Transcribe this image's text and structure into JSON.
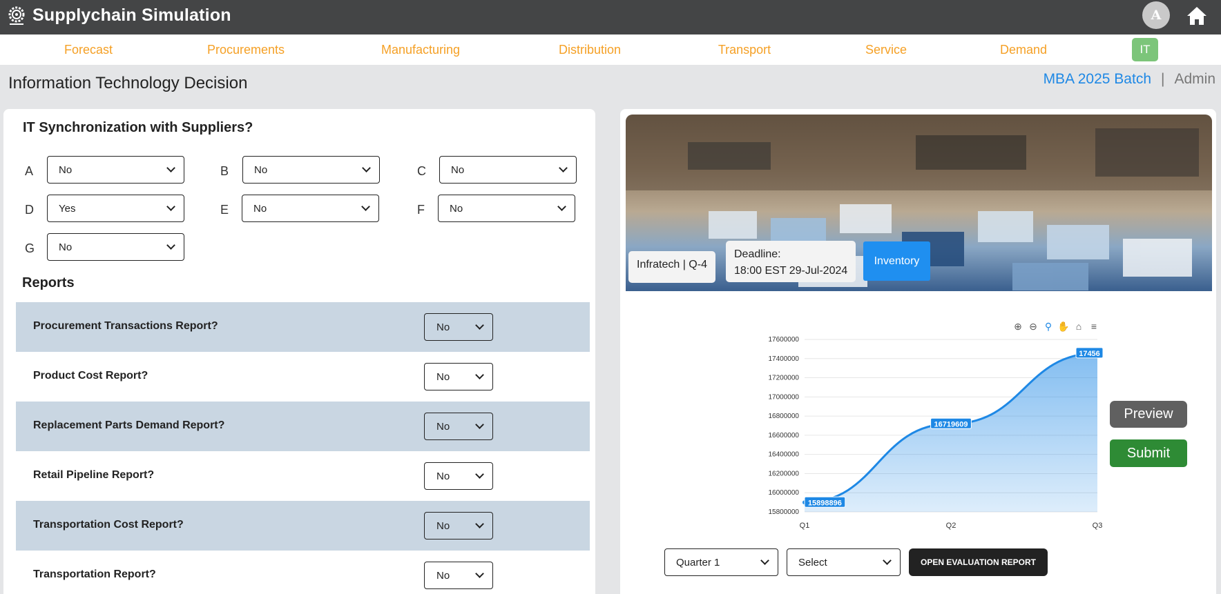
{
  "app": {
    "title": "Supplychain Simulation",
    "avatar_letter": "A"
  },
  "nav": {
    "items": [
      "Forecast",
      "Procurements",
      "Manufacturing",
      "Distribution",
      "Transport",
      "Service",
      "Demand"
    ],
    "active": "IT"
  },
  "page": {
    "title": "Information Technology Decision",
    "batch": "MBA 2025 Batch",
    "separator": "|",
    "role": "Admin"
  },
  "sync": {
    "title": "IT Synchronization with Suppliers?",
    "fields": [
      {
        "label": "A",
        "value": "No"
      },
      {
        "label": "B",
        "value": "No"
      },
      {
        "label": "C",
        "value": "No"
      },
      {
        "label": "D",
        "value": "Yes"
      },
      {
        "label": "E",
        "value": "No"
      },
      {
        "label": "F",
        "value": "No"
      },
      {
        "label": "G",
        "value": "No"
      }
    ]
  },
  "reports": {
    "title": "Reports",
    "rows": [
      {
        "label": "Procurement Transactions Report?",
        "value": "No"
      },
      {
        "label": "Product Cost Report?",
        "value": "No"
      },
      {
        "label": "Replacement Parts Demand Report?",
        "value": "No"
      },
      {
        "label": "Retail Pipeline Report?",
        "value": "No"
      },
      {
        "label": "Transportation Cost Report?",
        "value": "No"
      },
      {
        "label": "Transportation Report?",
        "value": "No"
      }
    ]
  },
  "banner": {
    "team": "Infratech | Q-4",
    "deadline_label": "Deadline:",
    "deadline": "18:00 EST 29-Jul-2024",
    "inventory_label": "Inventory"
  },
  "actions": {
    "preview": "Preview",
    "submit": "Submit",
    "quarter": "Quarter 1",
    "select": "Select",
    "evaluation": "OPEN EVALUATION REPORT"
  },
  "chart_data": {
    "type": "area",
    "categories": [
      "Q1",
      "Q2",
      "Q3"
    ],
    "values": [
      15898896,
      16719609,
      17456900
    ],
    "data_labels": [
      "15898896",
      "16719609",
      "17456"
    ],
    "ylim": [
      15800000,
      17600000
    ],
    "yticks": [
      15800000,
      16000000,
      16200000,
      16400000,
      16600000,
      16800000,
      17000000,
      17200000,
      17400000,
      17600000
    ],
    "grid": true,
    "color": "#1e88e5"
  },
  "colors": {
    "accent": "#f5a025",
    "brand_blue": "#1e88e5",
    "submit_green": "#2e8b35",
    "topbar": "#444546"
  }
}
